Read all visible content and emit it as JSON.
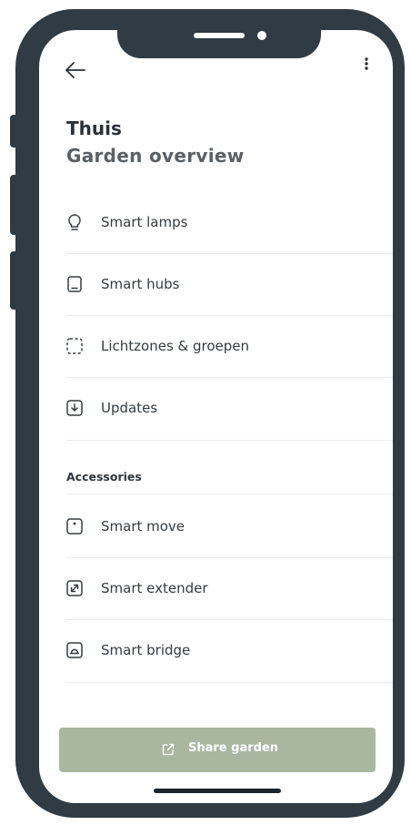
{
  "header": {
    "title": "Thuis",
    "subtitle": "Garden overview"
  },
  "menu": {
    "items": [
      {
        "label": "Smart lamps",
        "icon": "lightbulb-icon"
      },
      {
        "label": "Smart hubs",
        "icon": "hub-device-icon"
      },
      {
        "label": "Lichtzones & groepen",
        "icon": "zone-icon"
      },
      {
        "label": "Updates",
        "icon": "download-icon"
      }
    ]
  },
  "accessories": {
    "heading": "Accessories",
    "items": [
      {
        "label": "Smart move",
        "icon": "motion-sensor-icon"
      },
      {
        "label": "Smart extender",
        "icon": "extender-icon"
      },
      {
        "label": "Smart bridge",
        "icon": "bridge-icon"
      }
    ]
  },
  "footer": {
    "share_label": "Share garden",
    "share_icon": "share-icon"
  },
  "colors": {
    "frame": "#303b44",
    "button": "#a9b7a0",
    "text": "#353b41"
  }
}
